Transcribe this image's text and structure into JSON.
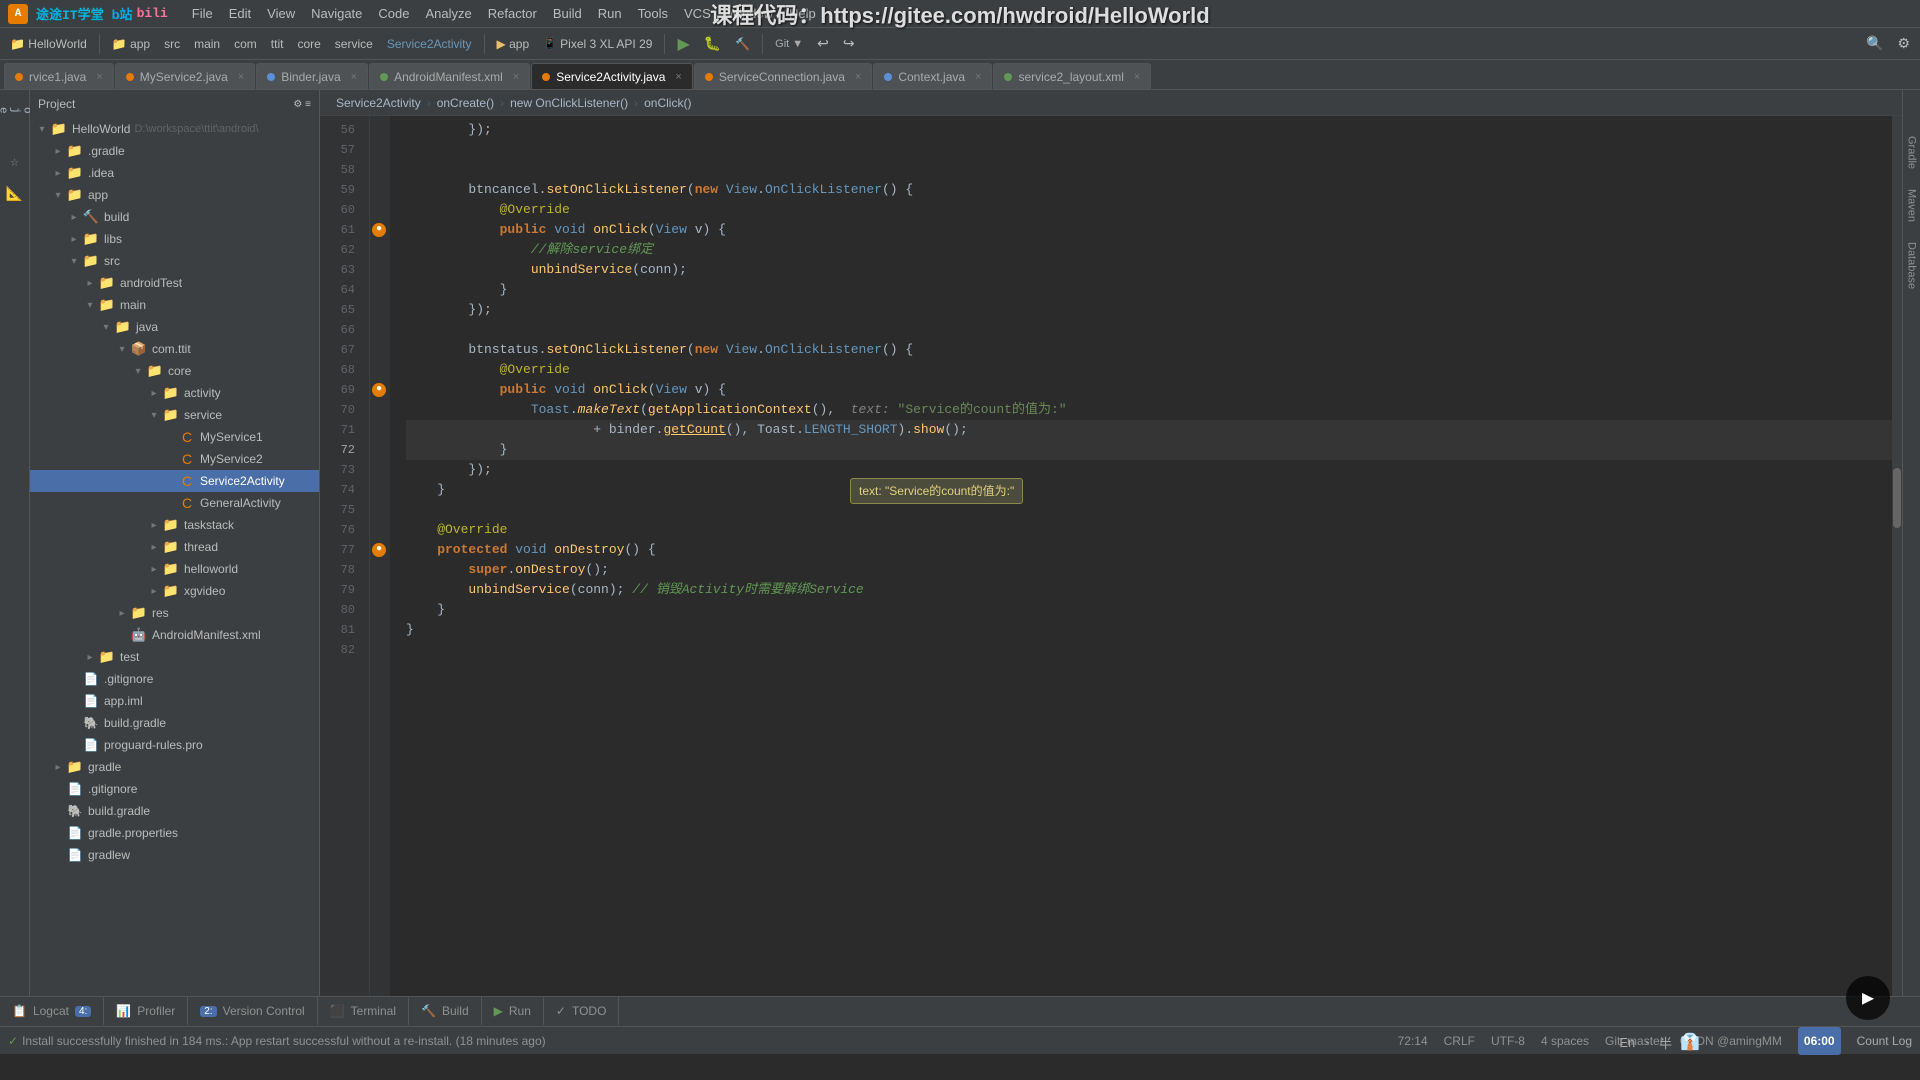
{
  "app": {
    "title": "HelloWorld",
    "logo_letter": "A"
  },
  "watermark": {
    "text": "课程代码：https://gitee.com/hwdroid/HelloWorld"
  },
  "menu": {
    "items": [
      "File",
      "Edit",
      "View",
      "Navigate",
      "Code",
      "Analyze",
      "Refactor",
      "Build",
      "Run",
      "Tools",
      "VCS",
      "Window",
      "Help"
    ]
  },
  "toolbar": {
    "project": "HelloWorld",
    "module": "app",
    "src": "src",
    "main": "main",
    "com": "com",
    "ttit": "ttit",
    "core": "core",
    "service": "service",
    "active_file": "Service2Activity",
    "config": "app",
    "device": "Pixel 3 XL API 29"
  },
  "file_tabs": [
    {
      "name": "rvice1.java",
      "type": "orange",
      "active": false
    },
    {
      "name": "MyService2.java",
      "type": "orange",
      "active": false
    },
    {
      "name": "Binder.java",
      "type": "blue",
      "active": false
    },
    {
      "name": "AndroidManifest.xml",
      "type": "green",
      "active": false
    },
    {
      "name": "Service2Activity.java",
      "type": "orange",
      "active": true
    },
    {
      "name": "ServiceConnection.java",
      "type": "orange",
      "active": false
    },
    {
      "name": "Context.java",
      "type": "blue",
      "active": false
    },
    {
      "name": "service2_layout.xml",
      "type": "green",
      "active": false
    }
  ],
  "sidebar": {
    "header": "Project",
    "tree": [
      {
        "id": "helloworld",
        "label": "HelloWorld",
        "level": 0,
        "type": "folder",
        "expanded": true,
        "path": "D:\\workspace\\ttit\\android\\"
      },
      {
        "id": "gradle1",
        "label": ".gradle",
        "level": 1,
        "type": "folder",
        "expanded": false
      },
      {
        "id": "idea",
        "label": ".idea",
        "level": 1,
        "type": "folder",
        "expanded": false
      },
      {
        "id": "app",
        "label": "app",
        "level": 1,
        "type": "folder",
        "expanded": true
      },
      {
        "id": "build",
        "label": "build",
        "level": 2,
        "type": "folder",
        "expanded": false,
        "icon": "build"
      },
      {
        "id": "libs",
        "label": "libs",
        "level": 2,
        "type": "folder",
        "expanded": false
      },
      {
        "id": "src",
        "label": "src",
        "level": 2,
        "type": "folder",
        "expanded": true
      },
      {
        "id": "androidTest",
        "label": "androidTest",
        "level": 3,
        "type": "folder",
        "expanded": false
      },
      {
        "id": "main",
        "label": "main",
        "level": 3,
        "type": "folder",
        "expanded": true
      },
      {
        "id": "java",
        "label": "java",
        "level": 4,
        "type": "folder",
        "expanded": true
      },
      {
        "id": "comttit",
        "label": "com.ttit",
        "level": 5,
        "type": "package",
        "expanded": true
      },
      {
        "id": "core",
        "label": "core",
        "level": 6,
        "type": "folder",
        "expanded": true
      },
      {
        "id": "activity",
        "label": "activity",
        "level": 7,
        "type": "folder",
        "expanded": false
      },
      {
        "id": "service",
        "label": "service",
        "level": 7,
        "type": "folder",
        "expanded": true
      },
      {
        "id": "myservice1",
        "label": "MyService1",
        "level": 8,
        "type": "class",
        "expanded": false
      },
      {
        "id": "myservice2",
        "label": "MyService2",
        "level": 8,
        "type": "class",
        "expanded": false
      },
      {
        "id": "service2activity",
        "label": "Service2Activity",
        "level": 8,
        "type": "class_selected",
        "expanded": false
      },
      {
        "id": "generalactivity",
        "label": "GeneralActivity",
        "level": 8,
        "type": "class",
        "expanded": false
      },
      {
        "id": "taskstack",
        "label": "taskstack",
        "level": 6,
        "type": "folder",
        "expanded": false
      },
      {
        "id": "thread",
        "label": "thread",
        "level": 6,
        "type": "folder",
        "expanded": false
      },
      {
        "id": "helloworld2",
        "label": "helloworld",
        "level": 6,
        "type": "folder",
        "expanded": false
      },
      {
        "id": "xgvideo",
        "label": "xgvideo",
        "level": 6,
        "type": "folder",
        "expanded": false
      },
      {
        "id": "res",
        "label": "res",
        "level": 4,
        "type": "folder",
        "expanded": false
      },
      {
        "id": "androidmanifest",
        "label": "AndroidManifest.xml",
        "level": 4,
        "type": "xml",
        "expanded": false
      },
      {
        "id": "test",
        "label": "test",
        "level": 3,
        "type": "folder",
        "expanded": false
      },
      {
        "id": "gitignore1",
        "label": ".gitignore",
        "level": 2,
        "type": "file"
      },
      {
        "id": "appml",
        "label": "app.iml",
        "level": 2,
        "type": "file"
      },
      {
        "id": "buildgradle",
        "label": "build.gradle",
        "level": 2,
        "type": "gradle"
      },
      {
        "id": "proguard",
        "label": "proguard-rules.pro",
        "level": 2,
        "type": "file"
      },
      {
        "id": "gradle2",
        "label": "gradle",
        "level": 1,
        "type": "folder",
        "expanded": false
      },
      {
        "id": "gitignore2",
        "label": ".gitignore",
        "level": 1,
        "type": "file"
      },
      {
        "id": "buildgradle2",
        "label": "build.gradle",
        "level": 1,
        "type": "gradle"
      },
      {
        "id": "gradleprops",
        "label": "gradle.properties",
        "level": 1,
        "type": "file"
      },
      {
        "id": "gradlew",
        "label": "gradlew",
        "level": 1,
        "type": "file"
      }
    ]
  },
  "breadcrumb": {
    "items": [
      "Service2Activity",
      "onCreate()",
      "new OnClickListener()",
      "onClick()"
    ]
  },
  "code": {
    "lines": [
      {
        "num": 56,
        "content": "        });",
        "type": "normal"
      },
      {
        "num": 57,
        "content": "",
        "type": "normal"
      },
      {
        "num": 58,
        "content": "",
        "type": "normal"
      },
      {
        "num": 59,
        "content": "        btncancel.setOnClickListener(new View.OnClickListener() {",
        "type": "normal",
        "gutter": ""
      },
      {
        "num": 60,
        "content": "            @Override",
        "type": "normal"
      },
      {
        "num": 61,
        "content": "            public void onClick(View v) {",
        "type": "normal",
        "gutter": "orange"
      },
      {
        "num": 62,
        "content": "                //解除service绑定",
        "type": "comment"
      },
      {
        "num": 63,
        "content": "                unbindService(conn);",
        "type": "normal"
      },
      {
        "num": 64,
        "content": "            }",
        "type": "normal"
      },
      {
        "num": 65,
        "content": "        });",
        "type": "normal"
      },
      {
        "num": 66,
        "content": "",
        "type": "normal"
      },
      {
        "num": 67,
        "content": "        btnstatus.setOnClickListener(new View.OnClickListener() {",
        "type": "normal"
      },
      {
        "num": 68,
        "content": "            @Override",
        "type": "normal"
      },
      {
        "num": 69,
        "content": "            public void onClick(View v) {",
        "type": "normal",
        "gutter": "orange"
      },
      {
        "num": 70,
        "content": "                Toast.makeText(getApplicationContext(),  text: \"Service的count的值为:\"",
        "type": "toast_line"
      },
      {
        "num": 71,
        "content": "                        + binder.getCount(), Toast.LENGTH_SHORT).show();",
        "type": "normal",
        "cursor": true
      },
      {
        "num": 72,
        "content": "            }",
        "type": "normal",
        "cursor": true
      },
      {
        "num": 73,
        "content": "        });",
        "type": "normal"
      },
      {
        "num": 74,
        "content": "    }",
        "type": "normal"
      },
      {
        "num": 75,
        "content": "",
        "type": "normal"
      },
      {
        "num": 76,
        "content": "    @Override",
        "type": "normal"
      },
      {
        "num": 77,
        "content": "    protected void onDestroy() {",
        "type": "normal",
        "gutter": "orange"
      },
      {
        "num": 78,
        "content": "        super.onDestroy();",
        "type": "normal"
      },
      {
        "num": 79,
        "content": "        unbindService(conn); // 销毁Activity时需要解绑Service",
        "type": "normal"
      },
      {
        "num": 80,
        "content": "    }",
        "type": "normal"
      },
      {
        "num": 81,
        "content": "}",
        "type": "normal"
      },
      {
        "num": 82,
        "content": "",
        "type": "normal"
      }
    ]
  },
  "bottom_tabs": [
    {
      "label": "Logcat",
      "icon": "📋"
    },
    {
      "label": "Profiler",
      "icon": "📊"
    },
    {
      "label": "Version Control",
      "icon": "2"
    },
    {
      "label": "Terminal",
      "icon": "⬛"
    },
    {
      "label": "Build",
      "icon": "🔨"
    },
    {
      "label": "Run",
      "icon": "▶"
    },
    {
      "label": "TODO",
      "icon": "✓"
    }
  ],
  "status_bar": {
    "git": "Git: master",
    "encoding": "UTF-8",
    "line_col": "72:14",
    "line_sep": "CRLF",
    "indent": "4 spaces",
    "user": "CSDN @amingMM",
    "time": "06:00",
    "install_msg": "Install successfully finished in 184 ms.: App restart successful without a re-install. (18 minutes ago)"
  },
  "colors": {
    "accent": "#4A6EA8",
    "selected_bg": "#2d5a8e",
    "bg_dark": "#2b2b2b",
    "bg_sidebar": "#3c3f41"
  }
}
